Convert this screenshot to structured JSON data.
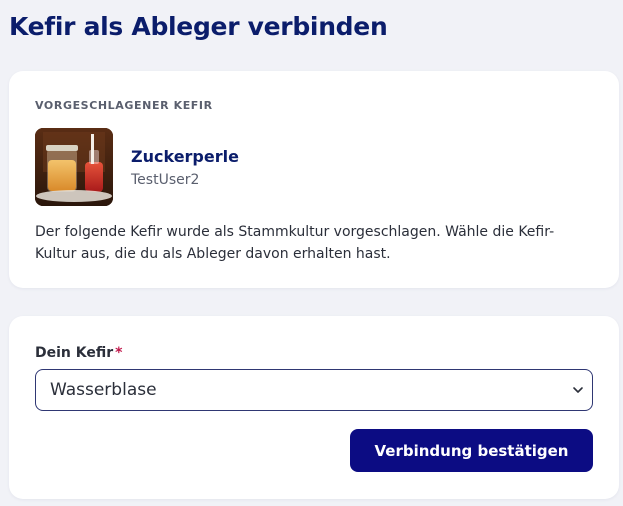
{
  "page": {
    "title": "Kefir als Ableger verbinden"
  },
  "suggested": {
    "section_label": "VORGESCHLAGENER KEFIR",
    "kefir_name": "Zuckerperle",
    "owner": "TestUser2",
    "description": "Der folgende Kefir wurde als Stammkultur vorgeschlagen. Wähle die Kefir-Kultur aus, die du als Ableger davon erhalten hast."
  },
  "form": {
    "field_label": "Dein Kefir",
    "required_mark": "*",
    "selected_value": "Wasserblase",
    "confirm_label": "Verbindung bestätigen"
  },
  "colors": {
    "title": "#0b1d6b",
    "button": "#0c0c83",
    "required": "#c0174a",
    "background": "#f1f2f7"
  },
  "icons": {
    "select_arrow": "chevron-down-icon",
    "thumbnail": "kefir-jars-image"
  }
}
